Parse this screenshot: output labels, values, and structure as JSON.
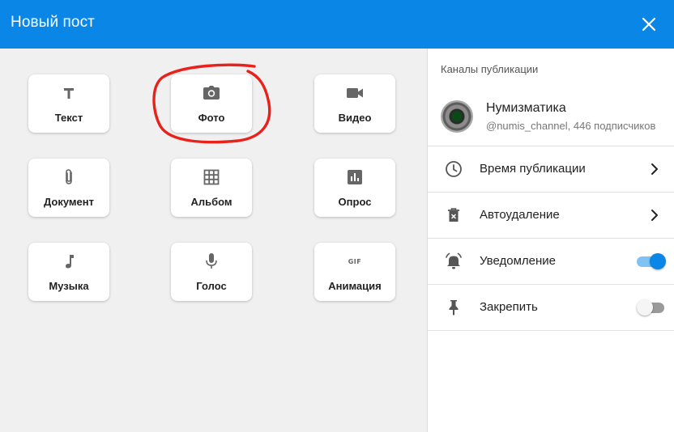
{
  "header": {
    "title": "Новый пост"
  },
  "tiles": [
    {
      "label": "Текст",
      "icon": "text-icon"
    },
    {
      "label": "Фото",
      "icon": "camera-icon"
    },
    {
      "label": "Видео",
      "icon": "video-icon"
    },
    {
      "label": "Документ",
      "icon": "attachment-icon"
    },
    {
      "label": "Альбом",
      "icon": "grid-icon"
    },
    {
      "label": "Опрос",
      "icon": "poll-icon"
    },
    {
      "label": "Музыка",
      "icon": "music-note-icon"
    },
    {
      "label": "Голос",
      "icon": "microphone-icon"
    },
    {
      "label": "Анимация",
      "icon": "gif-icon",
      "icon_text": "GIF"
    }
  ],
  "sidebar": {
    "section_title": "Каналы публикации",
    "channel": {
      "name": "Нумизматика",
      "subtitle": "@numis_channel, 446 подписчиков"
    },
    "options": [
      {
        "label": "Время публикации",
        "icon": "clock-icon",
        "control": "chevron"
      },
      {
        "label": "Автоудаление",
        "icon": "delete-timer-icon",
        "control": "chevron"
      },
      {
        "label": "Уведомление",
        "icon": "bell-icon",
        "control": "toggle",
        "enabled": true
      },
      {
        "label": "Закрепить",
        "icon": "pin-icon",
        "control": "toggle",
        "enabled": false
      }
    ]
  },
  "colors": {
    "accent": "#0a86e6",
    "highlight": "#e8211b",
    "panel_bg": "#f0f0f0"
  }
}
